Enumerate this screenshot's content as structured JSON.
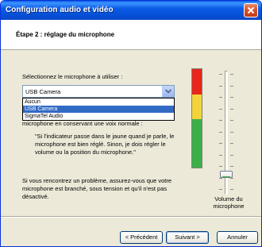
{
  "window": {
    "title": "Configuration audio et vidéo",
    "close_icon": "close-icon"
  },
  "header": {
    "step_title": "Étape 2 : réglage du microphone"
  },
  "main": {
    "prompt": "Sélectionnez le microphone à utiliser :",
    "combo": {
      "value": "USB Camera",
      "arrow_icon": "chevron-down-icon"
    },
    "dropdown": {
      "options": [
        "Aucun",
        "USB Camera",
        "SigmaTel Audio"
      ],
      "selected_index": 1
    },
    "info_line": "microphone en conservant une voix normale :",
    "quote": "\"Si l'indicateur passe dans le jaune quand je parle, le microphone est bien réglé. Sinon, je dois régler le volume ou la position du microphone.\"",
    "tip": "Si vous rencontrez un problème, assurez-vous que votre microphone est branché, sous tension et qu'il n'est pas désactivé."
  },
  "level_meter": {
    "colors": {
      "red": "#e8261b",
      "yellow": "#f2d43a",
      "green": "#3bb049"
    },
    "level": 1.0
  },
  "volume": {
    "label": "Volume du microphone",
    "level": 0.14
  },
  "footer": {
    "back_label": "< Précédent",
    "next_label": "Suivant >",
    "cancel_label": "Annuler"
  }
}
